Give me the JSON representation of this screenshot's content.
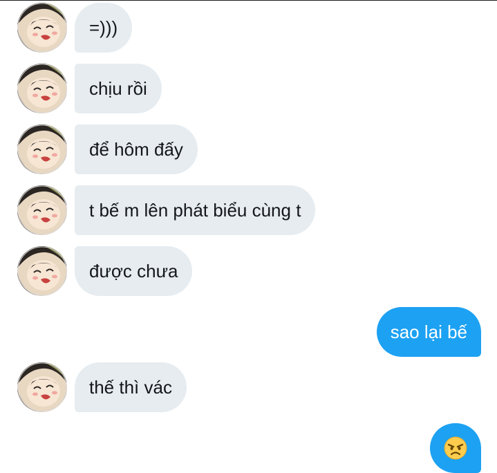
{
  "conversation": {
    "messages": [
      {
        "direction": "incoming",
        "text": "=)))"
      },
      {
        "direction": "incoming",
        "text": "chịu rồi"
      },
      {
        "direction": "incoming",
        "text": "để hôm đấy"
      },
      {
        "direction": "incoming",
        "text": "t bế m lên phát biểu cùng t"
      },
      {
        "direction": "incoming",
        "text": "được chưa"
      },
      {
        "direction": "outgoing",
        "text": "sao lại bế"
      },
      {
        "direction": "incoming",
        "text": "thế thì vác"
      },
      {
        "direction": "outgoing",
        "emoji": "angry-face-emoji"
      }
    ]
  },
  "colors": {
    "incoming_bubble": "#e6ecf0",
    "outgoing_bubble": "#1da1f2",
    "incoming_text": "#14171a",
    "outgoing_text": "#ffffff"
  }
}
